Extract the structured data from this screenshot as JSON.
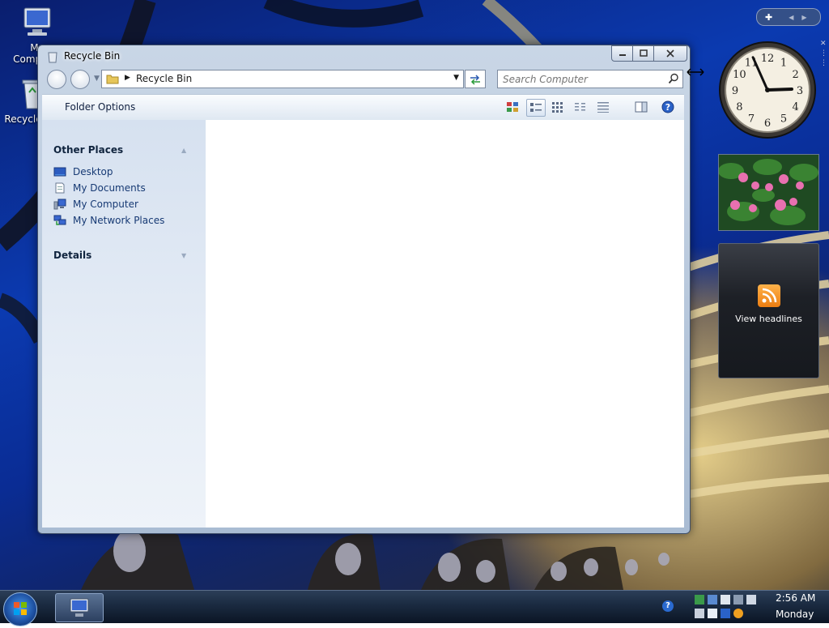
{
  "desktop": {
    "icons": [
      {
        "label": "My Computer"
      },
      {
        "label": "Recycle Bin"
      }
    ]
  },
  "window": {
    "title": "Recycle Bin",
    "address": {
      "crumb": "Recycle Bin"
    },
    "search": {
      "placeholder": "Search Computer"
    },
    "toolbar": {
      "folder_options_label": "Folder Options",
      "views": [
        "thumbnails",
        "tiles",
        "icons",
        "list",
        "details"
      ]
    },
    "left_pane": {
      "other_places": {
        "heading": "Other Places",
        "links": [
          "Desktop",
          "My Documents",
          "My Computer",
          "My Network Places"
        ]
      },
      "details": {
        "heading": "Details"
      }
    }
  },
  "gadgets": {
    "clock": {
      "hour": 2,
      "minute": 56
    },
    "feed": {
      "label": "View headlines"
    }
  },
  "taskbar": {
    "time": "2:56 AM",
    "day": "Monday"
  },
  "colors": {
    "window_frame": "#c9d6e6",
    "link": "#173a74",
    "taskbar": "#1a2a40",
    "rss_orange": "#ec7e12"
  }
}
